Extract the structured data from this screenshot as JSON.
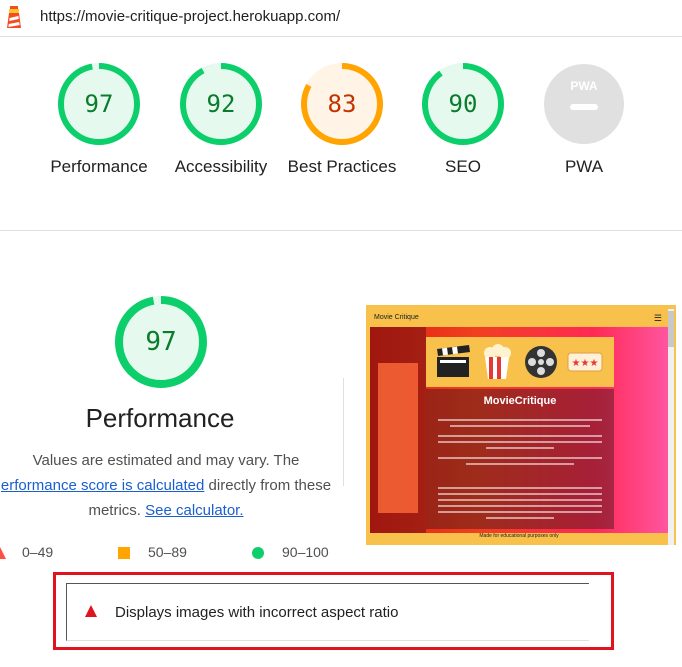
{
  "url_bar": {
    "url": "https://movie-critique-project.herokuapp.com/"
  },
  "scores": [
    {
      "label": "Performance",
      "score": "97",
      "fraction": 0.97,
      "color": "#0cce6b",
      "text_color": "#0a7d2c",
      "bg": "#e6f9ee"
    },
    {
      "label": "Accessibility",
      "score": "92",
      "fraction": 0.92,
      "color": "#0cce6b",
      "text_color": "#0a7d2c",
      "bg": "#e6f9ee"
    },
    {
      "label": "Best Practices",
      "score": "83",
      "fraction": 0.83,
      "color": "#ffa400",
      "text_color": "#c33300",
      "bg": "#fff4e6"
    },
    {
      "label": "SEO",
      "score": "90",
      "fraction": 0.9,
      "color": "#0cce6b",
      "text_color": "#0a7d2c",
      "bg": "#e6f9ee"
    },
    {
      "label": "PWA",
      "badge": "PWA"
    }
  ],
  "performance": {
    "score": "97",
    "fraction": 0.97,
    "title": "Performance",
    "desc_1": "Values are estimated and may vary. The",
    "link_1": "erformance score is calculated",
    "desc_2": " directly from these",
    "desc_3": "metrics. ",
    "link_2": "See calculator."
  },
  "legend": [
    {
      "icon": "triangle-icon",
      "range": "0–49",
      "color": "#ff4e42"
    },
    {
      "icon": "square-icon",
      "range": "50–89",
      "color": "#ffa400"
    },
    {
      "icon": "circle-icon",
      "range": "90–100",
      "color": "#0cce6b"
    }
  ],
  "screenshot": {
    "header": "Movie Critique",
    "title": "MovieCritique",
    "footer": "Made for educational purposes only"
  },
  "audit": {
    "text": "Displays images with incorrect aspect ratio",
    "color": "#e0141e"
  }
}
